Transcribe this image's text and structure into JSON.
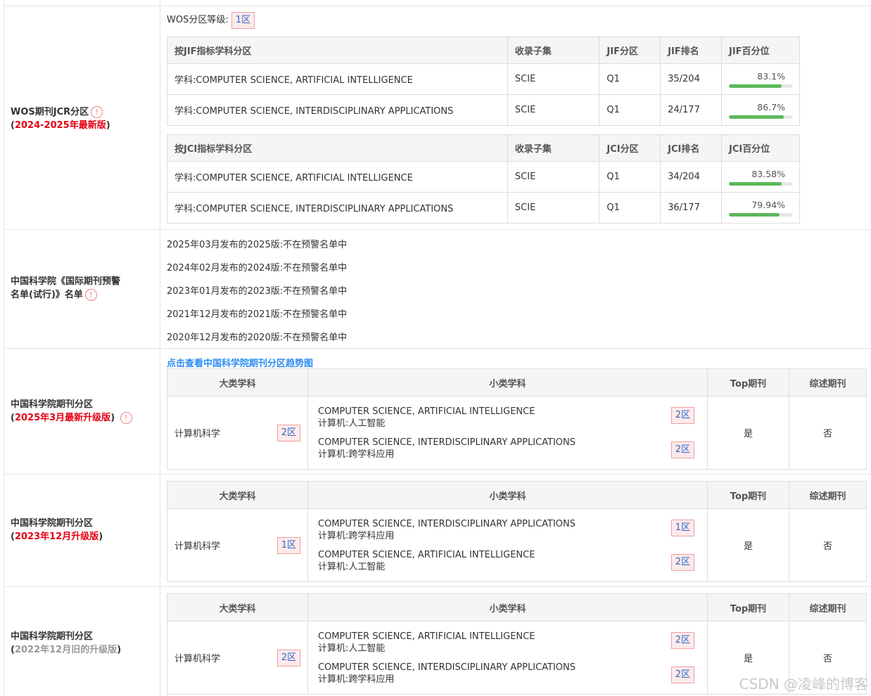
{
  "wos": {
    "label": "WOS期刊JCR分区",
    "edition": "2024-2025年最新版",
    "grade_label": "WOS分区等级:",
    "grade": "1区",
    "jif_headers": [
      "按JIF指标学科分区",
      "收录子集",
      "JIF分区",
      "JIF排名",
      "JIF百分位"
    ],
    "jif_rows": [
      {
        "subject": "学科:COMPUTER SCIENCE, ARTIFICIAL INTELLIGENCE",
        "set": "SCIE",
        "q": "Q1",
        "rank": "35/204",
        "pct": "83.1%",
        "pct_value": 83.1
      },
      {
        "subject": "学科:COMPUTER SCIENCE, INTERDISCIPLINARY APPLICATIONS",
        "set": "SCIE",
        "q": "Q1",
        "rank": "24/177",
        "pct": "86.7%",
        "pct_value": 86.7
      }
    ],
    "jci_headers": [
      "按JCI指标学科分区",
      "收录子集",
      "JCI分区",
      "JCI排名",
      "JCI百分位"
    ],
    "jci_rows": [
      {
        "subject": "学科:COMPUTER SCIENCE, ARTIFICIAL INTELLIGENCE",
        "set": "SCIE",
        "q": "Q1",
        "rank": "34/204",
        "pct": "83.58%",
        "pct_value": 83.58
      },
      {
        "subject": "学科:COMPUTER SCIENCE, INTERDISCIPLINARY APPLICATIONS",
        "set": "SCIE",
        "q": "Q1",
        "rank": "36/177",
        "pct": "79.94%",
        "pct_value": 79.94
      }
    ]
  },
  "warning": {
    "label_line1": "中国科学院《国际期刊预警",
    "label_line2": "名单(试行)》名单",
    "lines": [
      "2025年03月发布的2025版:不在预警名单中",
      "2024年02月发布的2024版:不在预警名单中",
      "2023年01月发布的2023版:不在预警名单中",
      "2021年12月发布的2021版:不在预警名单中",
      "2020年12月发布的2020版:不在预警名单中"
    ]
  },
  "cas_link": "点击查看中国科学院期刊分区趋势图",
  "cas_headers": [
    "大类学科",
    "小类学科",
    "Top期刊",
    "综述期刊"
  ],
  "cas": [
    {
      "label": "中国科学院期刊分区",
      "edition": "2025年3月最新升级版",
      "big": "计算机科学",
      "big_zone": "2区",
      "subs": [
        {
          "en": "COMPUTER SCIENCE, ARTIFICIAL INTELLIGENCE",
          "cn": "计算机:人工智能",
          "zone": "2区"
        },
        {
          "en": "COMPUTER SCIENCE, INTERDISCIPLINARY APPLICATIONS",
          "cn": "计算机:跨学科应用",
          "zone": "2区"
        }
      ],
      "top": "是",
      "review": "否"
    },
    {
      "label": "中国科学院期刊分区",
      "edition": "2023年12月升级版",
      "big": "计算机科学",
      "big_zone": "1区",
      "subs": [
        {
          "en": "COMPUTER SCIENCE, INTERDISCIPLINARY APPLICATIONS",
          "cn": "计算机:跨学科应用",
          "zone": "1区"
        },
        {
          "en": "COMPUTER SCIENCE, ARTIFICIAL INTELLIGENCE",
          "cn": "计算机:人工智能",
          "zone": "2区"
        }
      ],
      "top": "是",
      "review": "否"
    },
    {
      "label": "中国科学院期刊分区",
      "edition": "2022年12月旧的升级版",
      "big": "计算机科学",
      "big_zone": "2区",
      "subs": [
        {
          "en": "COMPUTER SCIENCE, ARTIFICIAL INTELLIGENCE",
          "cn": "计算机:人工智能",
          "zone": "2区"
        },
        {
          "en": "COMPUTER SCIENCE, INTERDISCIPLINARY APPLICATIONS",
          "cn": "计算机:跨学科应用",
          "zone": "2区"
        }
      ],
      "top": "是",
      "review": "否"
    }
  ],
  "info_icon_glyph": "!",
  "watermark": "CSDN @凌峰的博客"
}
